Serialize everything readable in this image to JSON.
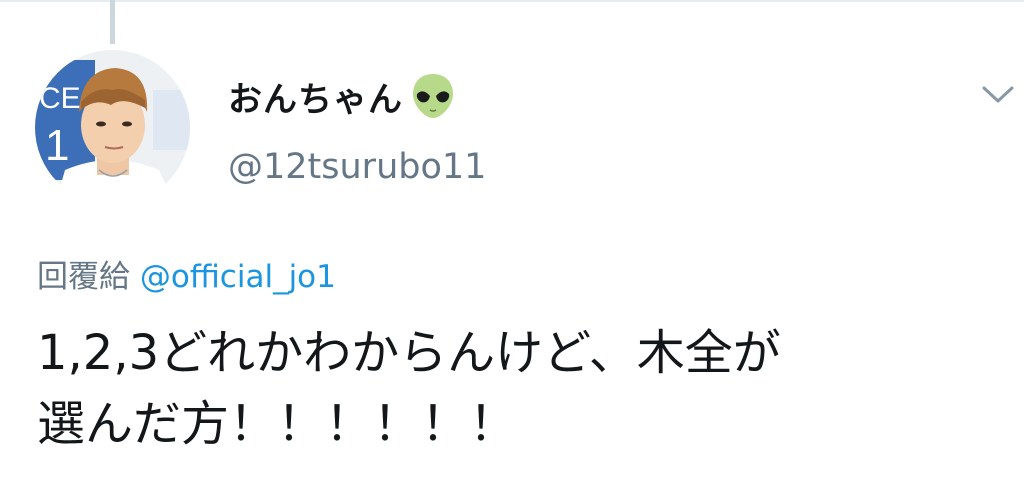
{
  "author": {
    "display_name": "おんちゃん",
    "emoji_icon": "alien-icon",
    "handle": "@12tsurubo11"
  },
  "reply": {
    "prefix": "回覆給",
    "mention": "@official_jo1"
  },
  "tweet": {
    "lines": [
      "1,2,3どれかわからんけど、木全が",
      "選んだ方！！！！！！"
    ]
  },
  "icons": {
    "menu": "chevron-down-icon"
  },
  "colors": {
    "text_primary": "#14171a",
    "text_secondary": "#657786",
    "link": "#1b95e0",
    "thread_line": "#ccd6dd"
  }
}
